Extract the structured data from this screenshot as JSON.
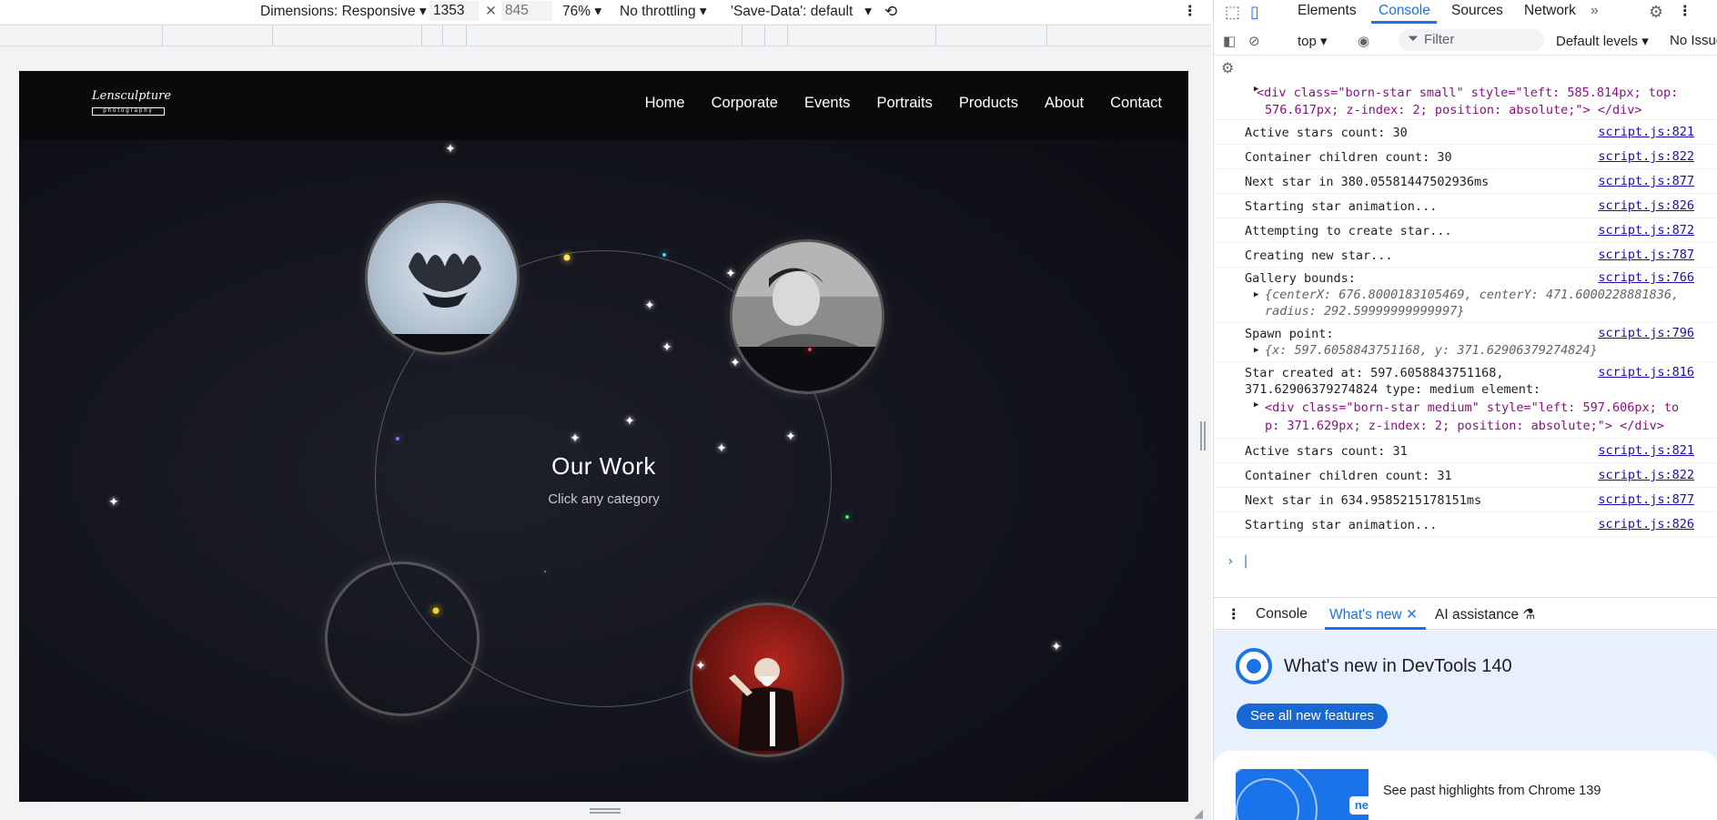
{
  "devtools_bar": {
    "dimensions_label": "Dimensions: Responsive",
    "width": "1353",
    "height_placeholder": "845",
    "zoom": "76%",
    "throttling": "No throttling",
    "save_data": "'Save-Data': default"
  },
  "site": {
    "logo_word": "Lensculpture",
    "logo_sub": "photography",
    "nav": [
      "Home",
      "Corporate",
      "Events",
      "Portraits",
      "Products",
      "About",
      "Contact"
    ],
    "title": "Our Work",
    "subtitle": "Click any category"
  },
  "devtools": {
    "tabs": [
      "Elements",
      "Console",
      "Sources",
      "Network"
    ],
    "active_tab": "Console",
    "context": "top",
    "filter_placeholder": "Filter",
    "levels": "Default levels",
    "issues": "No Issue",
    "console": [
      {
        "l1": "<div class=\"born-star small\" style=\"left: 585.814px; top:",
        "l2": "576.617px; z-index: 2; position: absolute;\"> </div>",
        "src": ""
      },
      {
        "l1": "Active stars count: 30",
        "src": "script.js:821"
      },
      {
        "l1": "Container children count: 30",
        "src": "script.js:822"
      },
      {
        "l1": "Next star in 380.05581447502936ms",
        "src": "script.js:877"
      },
      {
        "l1": "Starting star animation...",
        "src": "script.js:826"
      },
      {
        "l1": "Attempting to create star...",
        "src": "script.js:872"
      },
      {
        "l1": "Creating new star...",
        "src": "script.js:787"
      },
      {
        "l1": "Gallery bounds:",
        "l2": "{centerX: 676.8000183105469, centerY: 471.6000228881836,",
        "l3": "radius: 292.59999999999997}",
        "src": "script.js:766"
      },
      {
        "l1": "Spawn point:",
        "l2": "{x: 597.6058843751168, y: 371.62906379274824}",
        "src": "script.js:796"
      },
      {
        "l1": "Star created at: 597.6058843751168,",
        "l2": "371.62906379274824 type: medium element:",
        "l3": "<div class=\"born-star medium\" style=\"left: 597.606px; to",
        "l4": "p: 371.629px; z-index: 2; position: absolute;\"> </div>",
        "src": "script.js:816"
      },
      {
        "l1": "Active stars count: 31",
        "src": "script.js:821"
      },
      {
        "l1": "Container children count: 31",
        "src": "script.js:822"
      },
      {
        "l1": "Next star in 634.9585215178151ms",
        "src": "script.js:877"
      },
      {
        "l1": "Starting star animation...",
        "src": "script.js:826"
      }
    ],
    "drawer_tabs": [
      "Console",
      "What's new",
      "AI assistance"
    ],
    "whats_new_title": "What's new in DevTools 140",
    "whats_new_button": "See all new features",
    "new_badge": "new",
    "highlights": "See past highlights from Chrome 139"
  },
  "colors": {
    "accent": "#1a73e8",
    "site_bg": "#13141b"
  }
}
